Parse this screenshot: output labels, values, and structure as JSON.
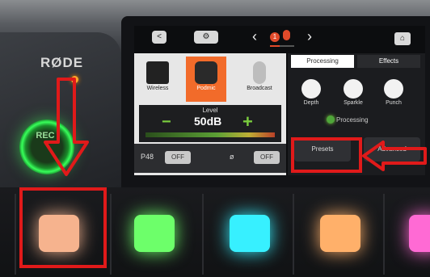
{
  "device": {
    "brand": "RØDE",
    "rec_label": "REC"
  },
  "screen": {
    "topbar": {
      "back_label": "<",
      "camera_label": "",
      "nav_prev": "‹",
      "nav_next": "›",
      "channel_number": "1"
    },
    "sources": [
      {
        "label": "Wireless",
        "icon": "wireless-icon",
        "active": false
      },
      {
        "label": "Podmic",
        "icon": "microphone-icon",
        "active": true
      },
      {
        "label": "Broadcast",
        "icon": "broadcast-mic-icon",
        "active": false
      }
    ],
    "level": {
      "label": "Level",
      "minus": "−",
      "plus": "+",
      "value": "50dB"
    },
    "phantom": {
      "p48_label": "P48",
      "p48_state": "OFF",
      "phase_label": "ø",
      "phase_state": "OFF"
    },
    "tabs": [
      {
        "label": "Processing",
        "selected": true
      },
      {
        "label": "Effects",
        "selected": false
      }
    ],
    "effects": [
      {
        "label": "Depth"
      },
      {
        "label": "Sparkle"
      },
      {
        "label": "Punch"
      }
    ],
    "processing_label": "Processing",
    "presets_label": "Presets",
    "advanced_label": "Advanced"
  },
  "pads": [
    {
      "color": "#f6b38e"
    },
    {
      "color": "#6dff6a"
    },
    {
      "color": "#37f0ff"
    },
    {
      "color": "#ffb06a"
    },
    {
      "color": "#ff6ad4"
    }
  ],
  "colors": {
    "highlight": "#e01a1a",
    "accent_orange": "#f26b2a",
    "level_green": "#7acd3e"
  }
}
